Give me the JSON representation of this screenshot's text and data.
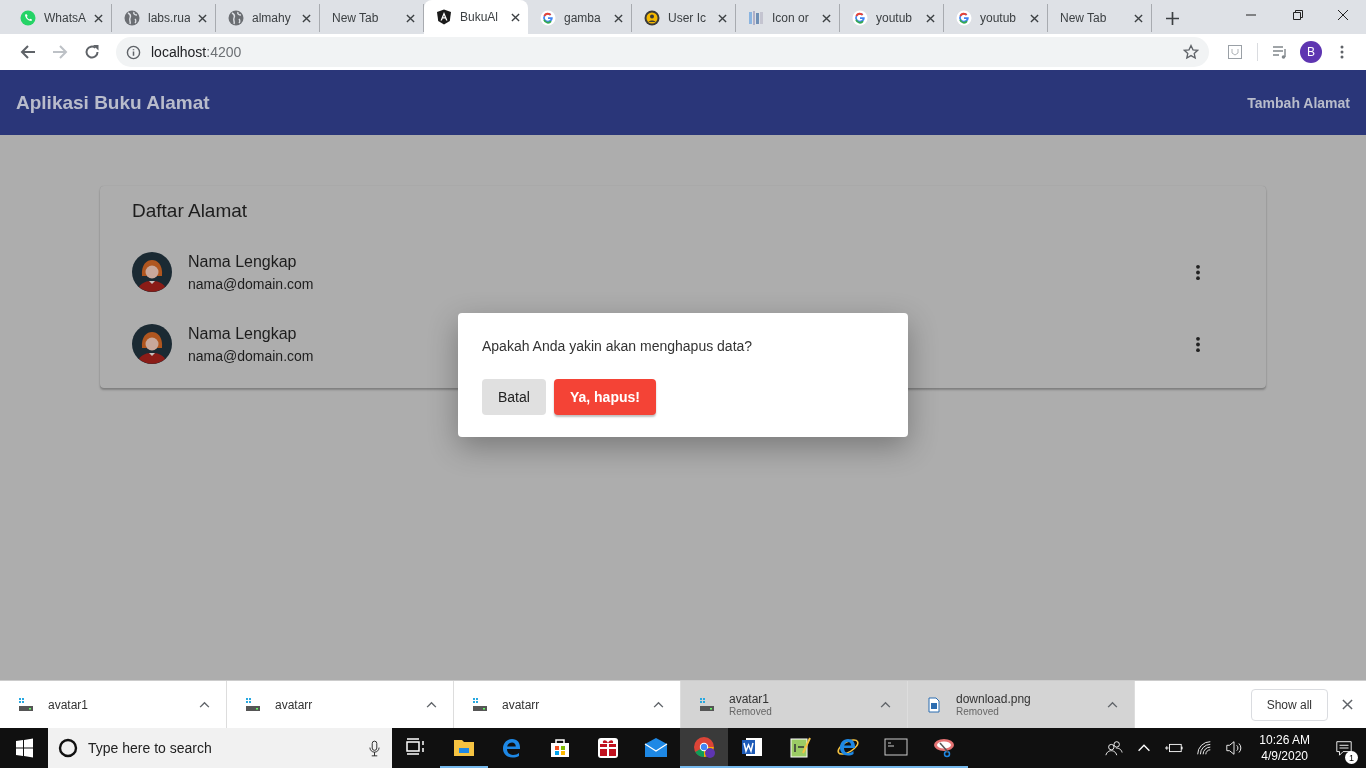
{
  "browser": {
    "tabs": [
      {
        "title": "WhatsA",
        "kind": "chat",
        "selected": false
      },
      {
        "title": "labs.rua",
        "kind": "globe",
        "selected": false
      },
      {
        "title": "almahy",
        "kind": "globe",
        "selected": false
      },
      {
        "title": "New Tab",
        "kind": "blank",
        "selected": false
      },
      {
        "title": "BukuAl",
        "kind": "shield",
        "selected": true
      },
      {
        "title": "gamba",
        "kind": "search",
        "selected": false
      },
      {
        "title": "User Ic",
        "kind": "user",
        "selected": false
      },
      {
        "title": "Icon or",
        "kind": "image",
        "selected": false
      },
      {
        "title": "youtub",
        "kind": "search",
        "selected": false
      },
      {
        "title": "youtub",
        "kind": "search",
        "selected": false
      },
      {
        "title": "New Tab",
        "kind": "blank",
        "selected": false
      }
    ],
    "address": {
      "host": "localhost",
      "port": ":4200"
    },
    "profile": "B"
  },
  "app": {
    "title": "Aplikasi Buku Alamat",
    "action": "Tambah Alamat",
    "list_title": "Daftar Alamat",
    "contacts": [
      {
        "name": "Nama Lengkap",
        "email": "nama@domain.com"
      },
      {
        "name": "Nama Lengkap",
        "email": "nama@domain.com"
      }
    ]
  },
  "dialog": {
    "message": "Apakah Anda yakin akan menghapus data?",
    "cancel": "Batal",
    "confirm": "Ya, hapus!"
  },
  "downloads": {
    "items": [
      {
        "name": "avatar1",
        "kind": "file"
      },
      {
        "name": "avatarr",
        "kind": "file"
      },
      {
        "name": "avatarr",
        "kind": "file"
      },
      {
        "name": "avatar1",
        "status": "Removed",
        "kind": "file"
      },
      {
        "name": "download.png",
        "status": "Removed",
        "kind": "image"
      }
    ],
    "show_all": "Show all"
  },
  "taskbar": {
    "search_placeholder": "Type here to search",
    "apps": [
      {
        "kind": "taskview",
        "running": false,
        "selected": false
      },
      {
        "kind": "explorer",
        "running": true,
        "selected": false
      },
      {
        "kind": "edge",
        "running": false,
        "selected": false
      },
      {
        "kind": "store",
        "running": false,
        "selected": false
      },
      {
        "kind": "gift",
        "running": false,
        "selected": false
      },
      {
        "kind": "mail",
        "running": false,
        "selected": false
      },
      {
        "kind": "chrome",
        "running": true,
        "selected": true
      },
      {
        "kind": "word",
        "running": true,
        "selected": false
      },
      {
        "kind": "notepad",
        "running": true,
        "selected": false
      },
      {
        "kind": "ie",
        "running": true,
        "selected": false
      },
      {
        "kind": "cmd",
        "running": true,
        "selected": false
      },
      {
        "kind": "snip",
        "running": true,
        "selected": false
      }
    ],
    "time": "10:26 AM",
    "date": "4/9/2020",
    "notifications": "1"
  }
}
